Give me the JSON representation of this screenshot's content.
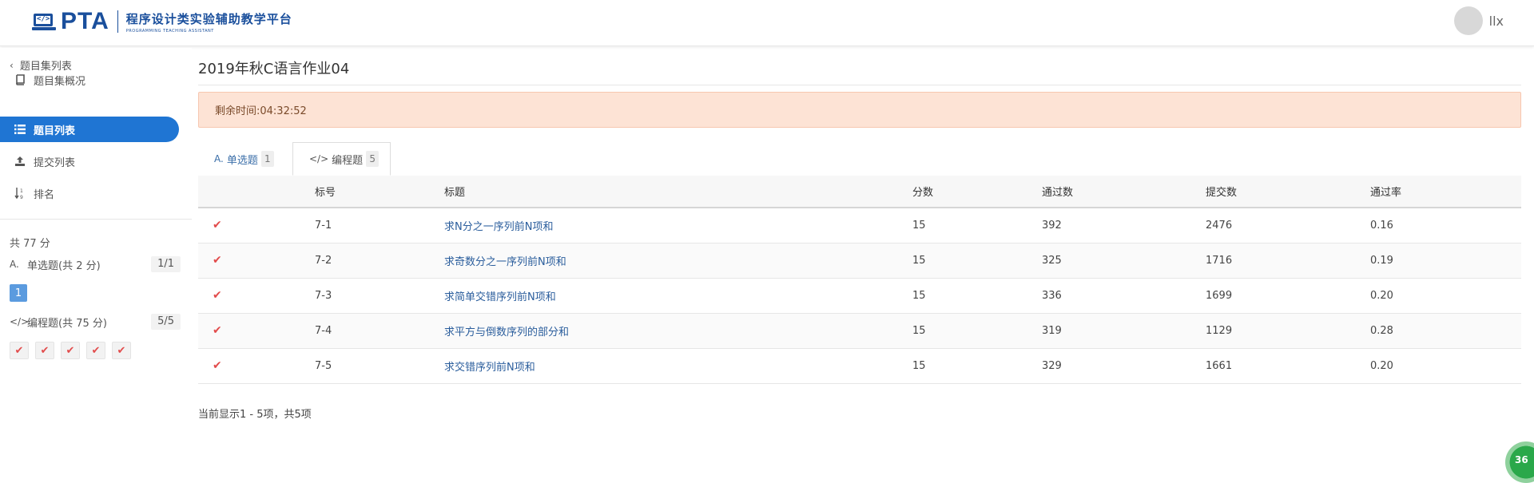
{
  "header": {
    "logo_text": "PTA",
    "logo_cn": "程序设计类实验辅助教学平台",
    "logo_en": "PROGRAMMING TEACHING ASSISTANT",
    "logo_code": "</>",
    "username": "llx"
  },
  "sidebar": {
    "back_label": "题目集列表",
    "items": [
      {
        "label": "题目集概况",
        "icon": "book-icon"
      },
      {
        "label": "题目列表",
        "icon": "list-icon"
      },
      {
        "label": "提交列表",
        "icon": "upload-icon"
      },
      {
        "label": "排名",
        "icon": "sort-icon"
      }
    ],
    "total_score": "共 77 分",
    "sections": [
      {
        "label": "单选题(共 2 分)",
        "ratio": "1/1",
        "icon": "A.",
        "chips": [
          "1"
        ]
      },
      {
        "label": "编程题(共 75 分)",
        "ratio": "5/5",
        "icon": "</>",
        "chips": [
          "✔",
          "✔",
          "✔",
          "✔",
          "✔"
        ]
      }
    ]
  },
  "main": {
    "title": "2019年秋C语言作业04",
    "timer": "剩余时间:04:32:52",
    "tabs": [
      {
        "icon": "A.",
        "label": "单选题",
        "count": "1"
      },
      {
        "icon": "</>",
        "label": "编程题",
        "count": "5"
      }
    ],
    "table": {
      "headers": [
        "",
        "标号",
        "标题",
        "分数",
        "通过数",
        "提交数",
        "通过率"
      ],
      "rows": [
        {
          "status": "✔",
          "id": "7-1",
          "title": "求N分之一序列前N项和",
          "score": "15",
          "passed": "392",
          "submitted": "2476",
          "rate": "0.16"
        },
        {
          "status": "✔",
          "id": "7-2",
          "title": "求奇数分之一序列前N项和",
          "score": "15",
          "passed": "325",
          "submitted": "1716",
          "rate": "0.19"
        },
        {
          "status": "✔",
          "id": "7-3",
          "title": "求简单交错序列前N项和",
          "score": "15",
          "passed": "336",
          "submitted": "1699",
          "rate": "0.20"
        },
        {
          "status": "✔",
          "id": "7-4",
          "title": "求平方与倒数序列的部分和",
          "score": "15",
          "passed": "319",
          "submitted": "1129",
          "rate": "0.28"
        },
        {
          "status": "✔",
          "id": "7-5",
          "title": "求交错序列前N项和",
          "score": "15",
          "passed": "329",
          "submitted": "1661",
          "rate": "0.20"
        }
      ]
    },
    "pager": "当前显示1 - 5项，共5项"
  },
  "corner_badge": "36",
  "colors": {
    "accent": "#1f75d3",
    "brand": "#1a4f9c",
    "timer_bg": "#fde3d5",
    "check": "#e24b4b"
  }
}
